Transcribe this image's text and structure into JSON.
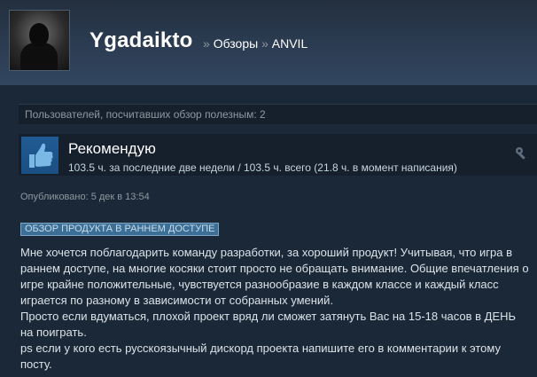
{
  "header": {
    "username": "Ygadaikto",
    "breadcrumb_sep": "»",
    "reviews_link": "Обзоры",
    "game": "ANVIL"
  },
  "helpful": {
    "text": "Пользователей, посчитавших обзор полезным: 2"
  },
  "recommendation": {
    "title": "Рекомендую",
    "hours": "103.5 ч. за последние две недели / 103.5 ч. всего (21.8 ч. в момент написания)",
    "thumb_icon": "thumbs-up-icon",
    "game_icon": "wrench-hammer-icon"
  },
  "posted": "Опубликовано: 5 дек в 13:54",
  "early_access_badge": "ОБЗОР ПРОДУКТА В РАННЕМ ДОСТУПЕ",
  "review": {
    "paragraphs": [
      "Мне хочется поблагодарить команду разработки, за хороший продукт! Учитывая, что игра в раннем доступе, на многие косяки стоит просто не обращать внимание. Общие впечатления о игре крайне положительные, чувствуется разнообразие в каждом классе и каждый класс играется по разному в зависимости от собранных умений.",
      "Просто если вдуматься, плохой проект вряд ли сможет затянуть Вас на 15-18 часов в ДЕНЬ на поиграть.",
      "ps если у кого есть русскоязычный дискорд проекта напишите его в комментарии к этому посту."
    ]
  },
  "colors": {
    "background": "#1b2838",
    "panel": "#16202d",
    "badge": "#3c6f96",
    "thumb": "#1a4f82"
  }
}
